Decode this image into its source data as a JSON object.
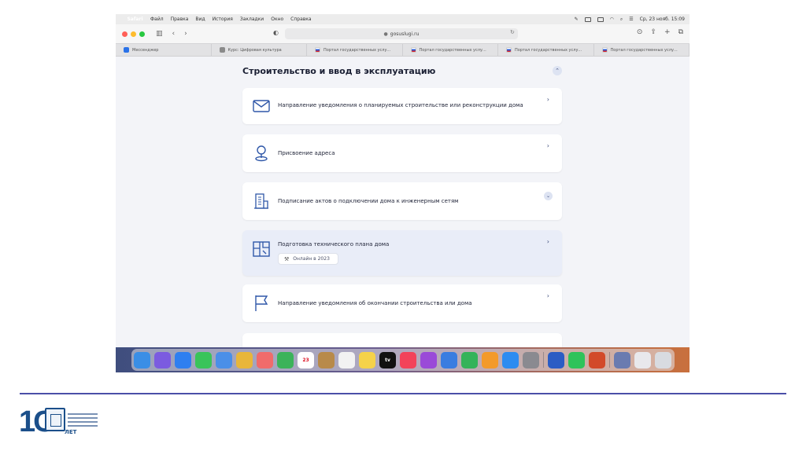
{
  "menubar": {
    "app_name": "Safari",
    "items": [
      "Файл",
      "Правка",
      "Вид",
      "История",
      "Закладки",
      "Окно",
      "Справка"
    ],
    "clock": "Ср, 23 нояб. 15:09"
  },
  "toolbar": {
    "url": "gosuslugi.ru"
  },
  "tabs": [
    {
      "label": "Мессенджер",
      "favicon": "blue"
    },
    {
      "label": "Курс: Цифровая культура",
      "favicon": "gray"
    },
    {
      "label": "Портал государственных услу...",
      "favicon": "flag"
    },
    {
      "label": "Портал государственных услу...",
      "favicon": "flag"
    },
    {
      "label": "Портал государственных услу...",
      "favicon": "flag"
    },
    {
      "label": "Портал государственных услу...",
      "favicon": "flag"
    }
  ],
  "section": {
    "title": "Строительство и ввод в эксплуатацию"
  },
  "cards": [
    {
      "label": "Направление уведомления о планируемых строительстве или реконструкции дома",
      "icon": "envelope-icon"
    },
    {
      "label": "Присвоение адреса",
      "icon": "location-pin-icon"
    },
    {
      "label": "Подписание актов о подключении дома к инженерным сетям",
      "icon": "building-icon"
    },
    {
      "label": "Подготовка технического плана дома",
      "icon": "floor-plan-icon",
      "badge": "Онлайн в 2023"
    },
    {
      "label": "Направление уведомления об окончании строительства или дома",
      "icon": "flag-icon"
    }
  ],
  "dock": {
    "calendar_day": "23",
    "tv_label": "tv"
  },
  "logo": {
    "text_big": "1С",
    "text_small": "ЛЕТ"
  },
  "colors": {
    "accent": "#2f57a8",
    "page_bg": "#f3f4f8",
    "footer_line": "#4b4fa8"
  }
}
